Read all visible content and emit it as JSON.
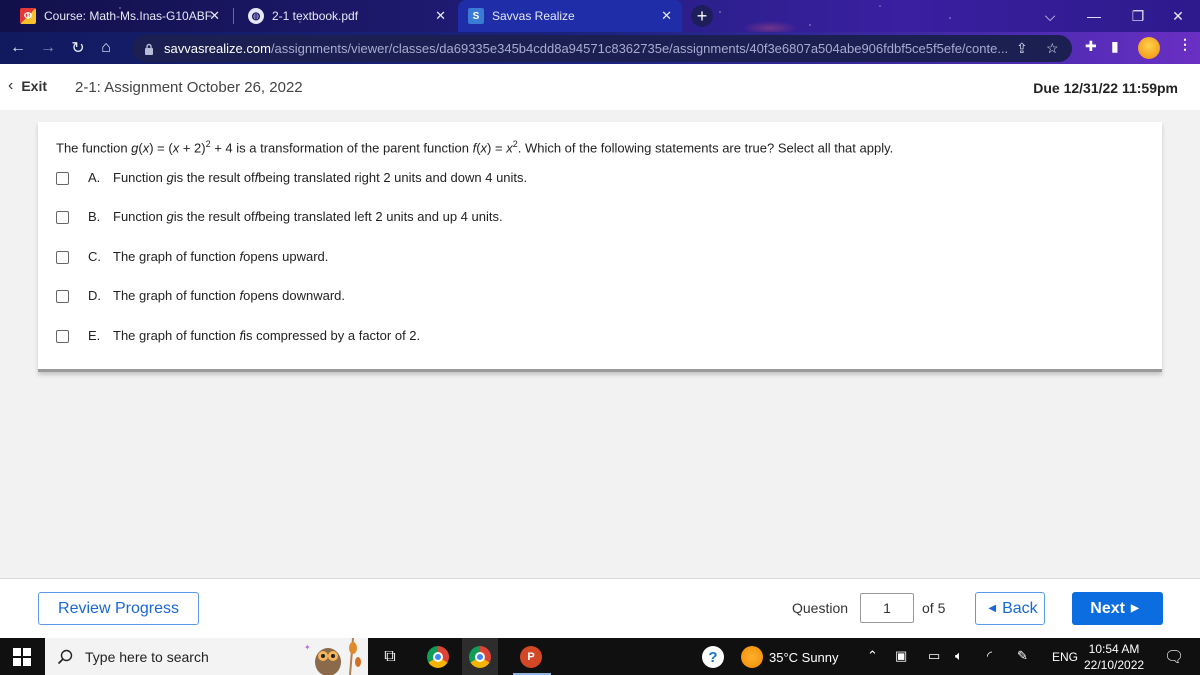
{
  "browser": {
    "tabs": [
      {
        "title": "Course: Math-Ms.Inas-G10ABF",
        "icon": "moodle-favicon-icon",
        "active": false
      },
      {
        "title": "2-1 textbook.pdf",
        "icon": "globe-icon",
        "active": false
      },
      {
        "title": "Savvas Realize",
        "icon": "savvas-favicon-icon",
        "active": true
      }
    ],
    "url_host": "savvasrealize.com",
    "url_path": "/assignments/viewer/classes/da69335e345b4cdd8a94571c8362735e/assignments/40f3e6807a504abe906fdbf5ce5f5efe/conte...",
    "favicon_letter": "S"
  },
  "header": {
    "exit_label": "Exit",
    "assignment_title": "2-1: Assignment October 26, 2022",
    "due": "Due 12/31/22 11:59pm"
  },
  "question": {
    "stem_parts": {
      "p1": "The function ",
      "g": "g",
      "p2": "(",
      "x1": "x",
      "p3": ") = (",
      "x2": "x",
      "p4": " + 2)",
      "sq1": "2",
      "p5": " + 4 is a transformation of the parent function ",
      "f": "f",
      "p6": "(",
      "x3": "x",
      "p7": ") = ",
      "x4": "x",
      "sq2": "2",
      "p8": ". Which of the following statements are true? Select all that apply."
    },
    "options": [
      {
        "letter": "A.",
        "pre": "Function ",
        "it1": "g",
        "mid": " is the result of ",
        "it2": "f",
        "post": " being translated right 2 units and down 4 units.",
        "checked": false
      },
      {
        "letter": "B.",
        "pre": "Function ",
        "it1": "g",
        "mid": " is the result of ",
        "it2": "f",
        "post": " being translated left 2 units and up 4 units.",
        "checked": false
      },
      {
        "letter": "C.",
        "pre": "The graph of function ",
        "it1": "f",
        "mid": "",
        "it2": "",
        "post": " opens upward.",
        "checked": false
      },
      {
        "letter": "D.",
        "pre": "The graph of function ",
        "it1": "f",
        "mid": "",
        "it2": "",
        "post": " opens downward.",
        "checked": false
      },
      {
        "letter": "E.",
        "pre": "The graph of function ",
        "it1": "f",
        "mid": "",
        "it2": "",
        "post": " is compressed by a factor of 2.",
        "checked": false
      }
    ]
  },
  "footer": {
    "review_label": "Review Progress",
    "question_label": "Question",
    "current_question": "1",
    "of_label": "of 5",
    "back_label": "Back",
    "next_label": "Next"
  },
  "taskbar": {
    "search_placeholder": "Type here to search",
    "weather": "35°C  Sunny",
    "language": "ENG",
    "time": "10:54 AM",
    "date": "22/10/2022"
  },
  "colors": {
    "accent": "#0b6de0",
    "link": "#1a67d8"
  }
}
